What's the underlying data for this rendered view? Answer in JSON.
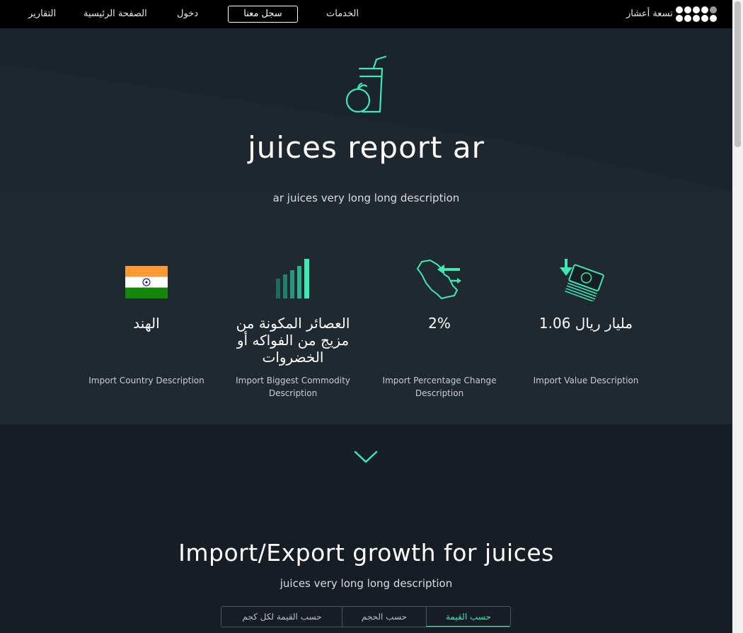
{
  "nav": {
    "brand_name": "تسعة أعشار",
    "services": "الخدمات",
    "register": "سجل معنا",
    "login": "دخول",
    "home": "الصفحة الرئيسية",
    "reports": "التقارير"
  },
  "hero": {
    "icon": "juice-fruit-icon",
    "title": "juices report ar",
    "description": "ar juices very long long description"
  },
  "stats": [
    {
      "icon": "india-flag",
      "value": "الهند",
      "description": "Import Country Description"
    },
    {
      "icon": "bar-chart-icon",
      "value": "العصائر المكونة من مزيج من الفواكه أو الخضروات",
      "description": "Import Biggest Commodity Description"
    },
    {
      "icon": "saudi-map-exchange-icon",
      "value": "2%",
      "description": "Import Percentage Change Description"
    },
    {
      "icon": "money-stack-icon",
      "value": "1.06 مليار ريال",
      "description": "Import Value Description"
    }
  ],
  "growth": {
    "title": "Import/Export growth for juices",
    "description": "juices very long long description",
    "tabs": [
      "حسب القيمة",
      "حسب الحجم",
      "حسب القيمة لكل كجم"
    ],
    "active_tab": "حسب القيمة"
  },
  "colors": {
    "accent": "#3de8b2",
    "background": "#161d25",
    "navbar": "#000000"
  }
}
